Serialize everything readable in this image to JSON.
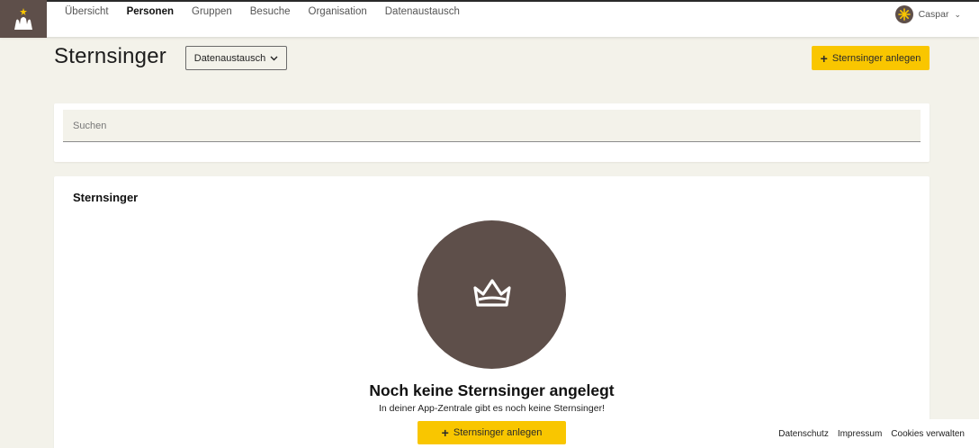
{
  "nav": {
    "items": [
      {
        "label": "Übersicht",
        "active": false
      },
      {
        "label": "Personen",
        "active": true
      },
      {
        "label": "Gruppen",
        "active": false
      },
      {
        "label": "Besuche",
        "active": false
      },
      {
        "label": "Organisation",
        "active": false
      },
      {
        "label": "Datenaustausch",
        "active": false
      }
    ]
  },
  "user": {
    "name": "Caspar",
    "icon": "star-icon"
  },
  "header": {
    "title": "Sternsinger",
    "dropdown_label": "Datenaustausch",
    "add_label": "Sternsinger anlegen"
  },
  "search": {
    "placeholder": "Suchen",
    "value": ""
  },
  "list": {
    "title": "Sternsinger",
    "empty_icon": "crown-icon",
    "empty_title": "Noch keine Sternsinger angelegt",
    "empty_text": "In deiner App-Zentrale gibt es noch keine Sternsinger!",
    "empty_button": "Sternsinger anlegen"
  },
  "footer": {
    "links": [
      "Datenschutz",
      "Impressum",
      "Cookies verwalten"
    ]
  },
  "colors": {
    "accent": "#f9c600",
    "brand": "#5e4f4a",
    "background": "#f3f2ea"
  }
}
